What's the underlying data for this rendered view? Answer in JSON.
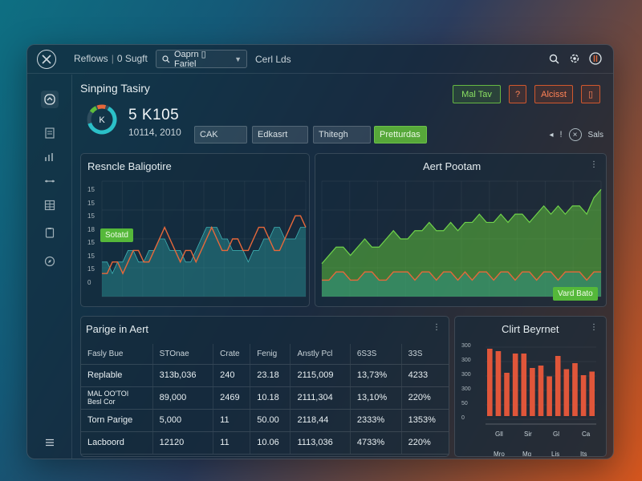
{
  "topbar": {
    "nav_items": [
      "Reflows",
      "0 Sugft"
    ],
    "separator": "|",
    "selector_label": "Oaprn ▯ Fariel",
    "extra_label": "Cerl Lds"
  },
  "header": {
    "title": "Sinping Tasiry",
    "gauge_letter": "K",
    "kpi_value": "5 K105",
    "kpi_sub": "10114, 2010",
    "filters": [
      "CAK",
      "Edkasrt",
      "Thitegh",
      "Pretturdas"
    ],
    "buttons": {
      "green": "Mal Tav",
      "small": "?",
      "orange": "Alcisst",
      "doc": "▯"
    },
    "tools_label": "Sals"
  },
  "chart_left": {
    "title": "Resncle Baligotire",
    "tag": "Sotatd",
    "y_ticks": [
      "15",
      "15",
      "15",
      "18",
      "15",
      "15",
      "15",
      "0"
    ]
  },
  "chart_right": {
    "title": "Aert Pootam",
    "more": "⋮",
    "tag": "Vard Bato"
  },
  "table_panel": {
    "title": "Parige in Aert",
    "more": "⋮",
    "columns": [
      "Fasly Bue",
      "STOnae",
      "Crate",
      "Fenig",
      "Anstly Pcl",
      "6S3S",
      "33S"
    ],
    "rows": [
      [
        "Replable",
        "313b,036",
        "240",
        "23.18",
        "2115,009",
        "13,73%",
        "4233"
      ],
      [
        "MAL OO'TOI\nBesl Cor",
        "89,000",
        "2469",
        "10.18",
        "2111,304",
        "13,10%",
        "220%"
      ],
      [
        "Torn Parige",
        "5,000",
        "11",
        "50.00",
        "2118,44",
        "2333%",
        "1353%"
      ],
      [
        "Lacboord",
        "12120",
        "11",
        "10.06",
        "1113,036",
        "4733%",
        "220%"
      ]
    ]
  },
  "bar_panel": {
    "title": "Clirt Beyrnet",
    "more": "⋮",
    "y_ticks": [
      "300",
      "300",
      "300",
      "300",
      "50",
      "0"
    ],
    "x_labels_top": [
      "Gll",
      "Sir",
      "Gl",
      "Ca"
    ],
    "x_labels_bottom": [
      "Mro",
      "Mg",
      "Lis",
      "Its"
    ]
  },
  "colors": {
    "accent_green": "#5dbd3b",
    "accent_orange": "#e8683a",
    "teal_fill": "#2a9a9c",
    "bar_red": "#e0563a"
  },
  "chart_data": [
    {
      "type": "area",
      "title": "Resncle Baligotire",
      "series": [
        {
          "values": [
            3,
            3,
            2,
            3,
            3,
            4,
            4,
            3,
            3,
            4,
            4,
            5,
            5,
            4,
            4,
            4,
            3,
            3,
            4,
            5,
            6,
            6,
            6,
            5,
            5,
            4,
            4,
            4,
            3,
            4,
            4,
            5,
            5,
            6,
            6,
            5,
            5,
            5,
            6,
            6
          ]
        },
        {
          "values": [
            2,
            2,
            3,
            3,
            2,
            3,
            4,
            4,
            3,
            3,
            4,
            5,
            6,
            5,
            4,
            3,
            4,
            4,
            3,
            4,
            5,
            6,
            5,
            4,
            4,
            5,
            5,
            4,
            4,
            5,
            6,
            6,
            5,
            4,
            4,
            5,
            6,
            7,
            7,
            6
          ]
        }
      ],
      "ylim": [
        0,
        10
      ]
    },
    {
      "type": "area",
      "title": "Aert Pootam",
      "series": [
        {
          "values": [
            4,
            5,
            6,
            6,
            5,
            6,
            7,
            6,
            6,
            7,
            8,
            7,
            7,
            8,
            8,
            9,
            8,
            8,
            9,
            8,
            9,
            9,
            10,
            9,
            9,
            10,
            9,
            10,
            10,
            9,
            10,
            11,
            10,
            11,
            10,
            11,
            11,
            10,
            12,
            13
          ]
        },
        {
          "values": [
            2,
            2,
            3,
            3,
            2,
            2,
            3,
            3,
            2,
            2,
            3,
            3,
            3,
            2,
            3,
            3,
            2,
            3,
            3,
            2,
            3,
            2,
            3,
            3,
            2,
            3,
            3,
            2,
            3,
            3,
            2,
            3,
            3,
            2,
            3,
            3,
            3,
            2,
            3,
            3
          ]
        }
      ],
      "ylim": [
        0,
        14
      ]
    },
    {
      "type": "bar",
      "title": "Clirt Beyrnet",
      "values": [
        280,
        270,
        180,
        260,
        260,
        200,
        210,
        165,
        250,
        195,
        220,
        170,
        185
      ],
      "ylim": [
        0,
        300
      ]
    }
  ]
}
